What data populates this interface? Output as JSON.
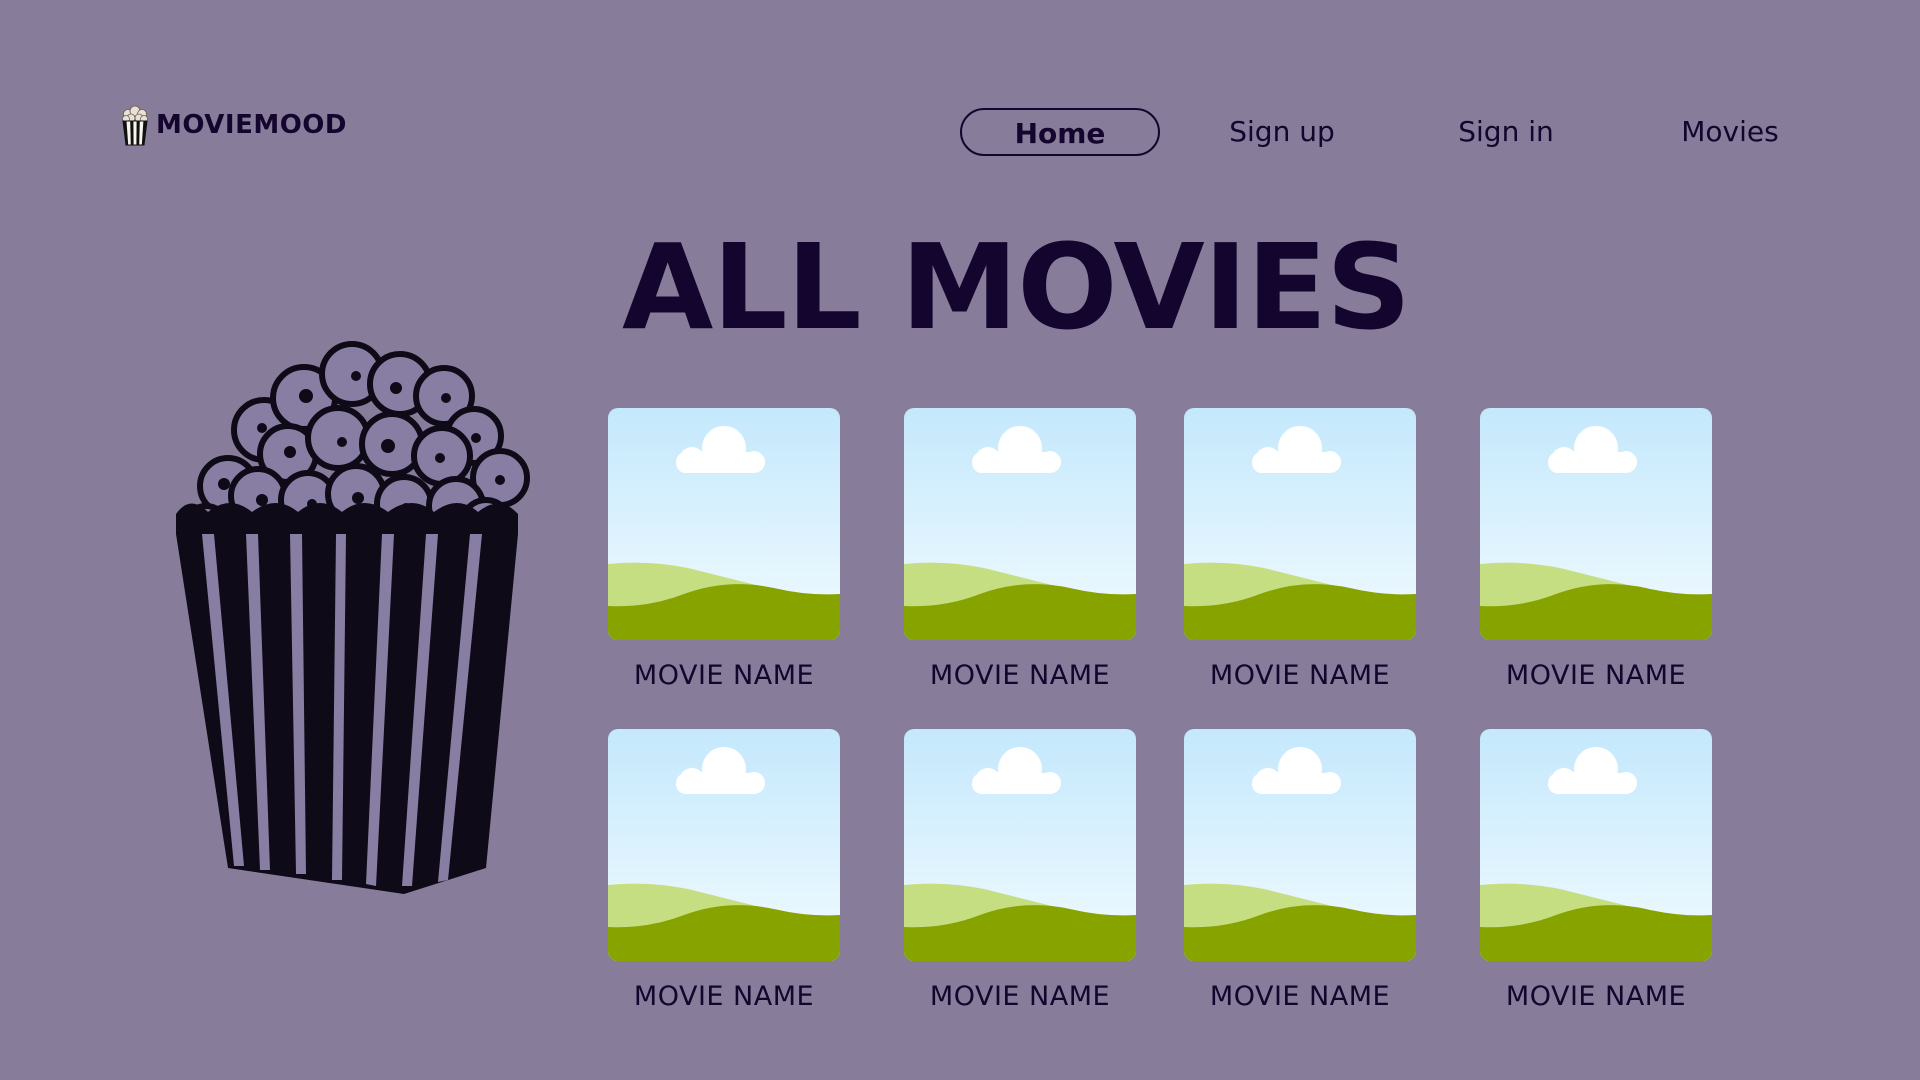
{
  "brand": {
    "name": "MOVIEMOOD",
    "icon": "popcorn-icon"
  },
  "nav": {
    "items": [
      {
        "label": "Home",
        "active": true
      },
      {
        "label": "Sign up",
        "active": false
      },
      {
        "label": "Sign in",
        "active": false
      },
      {
        "label": "Movies",
        "active": false
      }
    ]
  },
  "main": {
    "title": "ALL MOVIES",
    "illustration": "popcorn-bucket-illustration",
    "movies": [
      {
        "name": "MOVIE NAME",
        "thumbnail": "image-placeholder-icon"
      },
      {
        "name": "MOVIE NAME",
        "thumbnail": "image-placeholder-icon"
      },
      {
        "name": "MOVIE NAME",
        "thumbnail": "image-placeholder-icon"
      },
      {
        "name": "MOVIE NAME",
        "thumbnail": "image-placeholder-icon"
      },
      {
        "name": "MOVIE NAME",
        "thumbnail": "image-placeholder-icon"
      },
      {
        "name": "MOVIE NAME",
        "thumbnail": "image-placeholder-icon"
      },
      {
        "name": "MOVIE NAME",
        "thumbnail": "image-placeholder-icon"
      },
      {
        "name": "MOVIE NAME",
        "thumbnail": "image-placeholder-icon"
      }
    ]
  },
  "colors": {
    "background": "#877d9a",
    "text": "#14052e",
    "sky_top": "#c4e8fc",
    "sky_bottom": "#f2fbff",
    "hill_light": "#c5de82",
    "hill_dark": "#87a300"
  }
}
